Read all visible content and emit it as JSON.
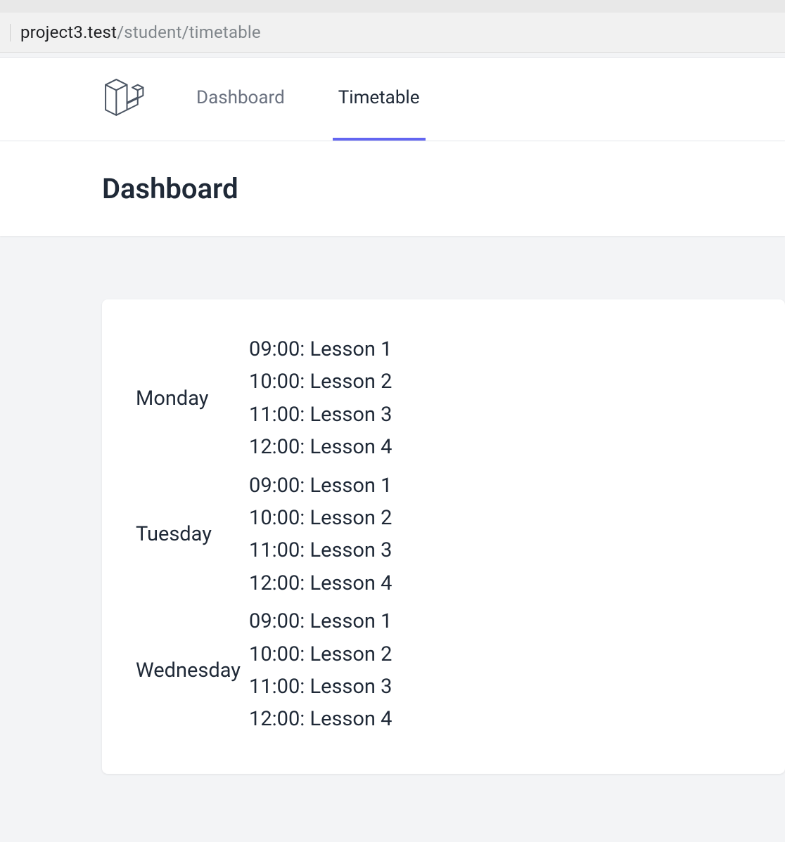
{
  "browser": {
    "url_host": "project3.test",
    "url_path": "/student/timetable"
  },
  "nav": {
    "items": [
      {
        "label": "Dashboard"
      },
      {
        "label": "Timetable"
      }
    ]
  },
  "header": {
    "title": "Dashboard"
  },
  "timetable": {
    "days": [
      {
        "name": "Monday",
        "lessons": [
          "09:00: Lesson 1",
          "10:00: Lesson 2",
          "11:00: Lesson 3",
          "12:00: Lesson 4"
        ]
      },
      {
        "name": "Tuesday",
        "lessons": [
          "09:00: Lesson 1",
          "10:00: Lesson 2",
          "11:00: Lesson 3",
          "12:00: Lesson 4"
        ]
      },
      {
        "name": "Wednesday",
        "lessons": [
          "09:00: Lesson 1",
          "10:00: Lesson 2",
          "11:00: Lesson 3",
          "12:00: Lesson 4"
        ]
      }
    ]
  }
}
